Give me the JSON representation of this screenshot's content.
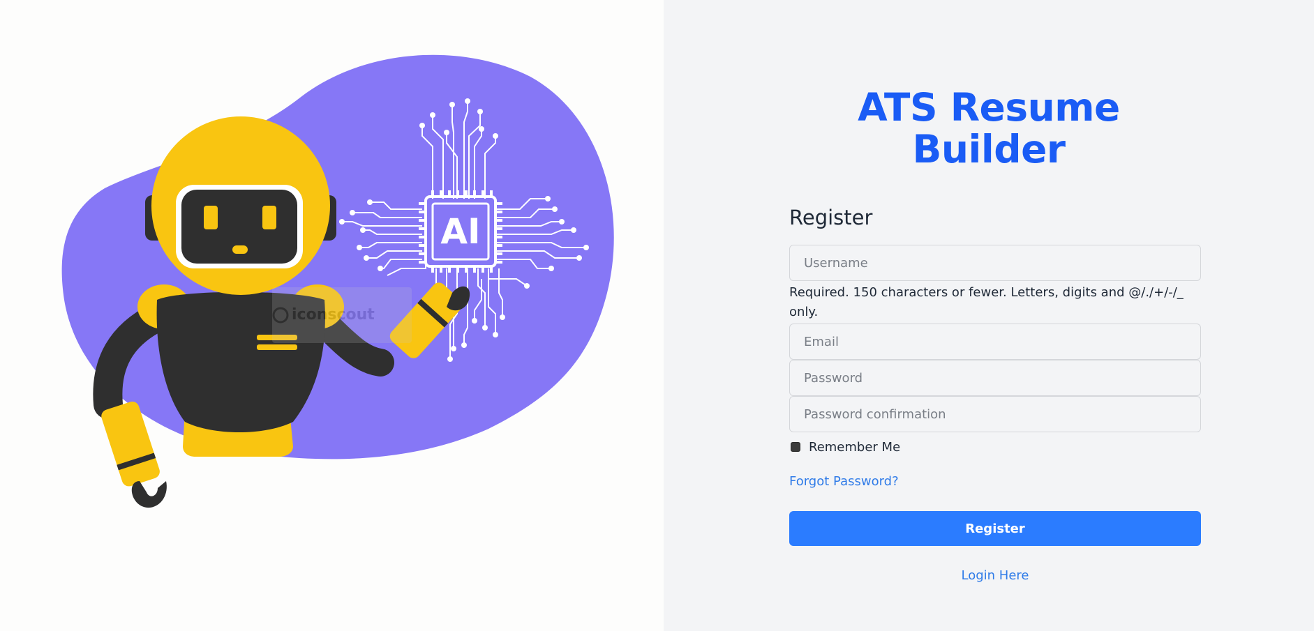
{
  "app": {
    "title_line1": "ATS Resume",
    "title_line2": "Builder"
  },
  "illustration": {
    "name": "robot-ai-chip-illustration",
    "chip_label": "AI",
    "watermark": "iconscout",
    "colors": {
      "blob": "#8677f6",
      "robot_yellow": "#f9c511",
      "robot_dark": "#2f2f2f",
      "circuit": "#ffffff"
    }
  },
  "form": {
    "heading": "Register",
    "username": {
      "placeholder": "Username",
      "value": ""
    },
    "username_help": "Required. 150 characters or fewer. Letters, digits and @/./+/-/_ only.",
    "email": {
      "placeholder": "Email",
      "value": ""
    },
    "password": {
      "placeholder": "Password",
      "value": ""
    },
    "password_confirmation": {
      "placeholder": "Password confirmation",
      "value": ""
    },
    "remember_me": {
      "label": "Remember Me",
      "checked": false
    },
    "forgot_password_label": "Forgot Password?",
    "submit_label": "Register",
    "login_link_label": "Login Here"
  },
  "colors": {
    "accent": "#2b7cff",
    "title": "#1a5cf5",
    "link": "#2f7be8",
    "panel_bg": "#f3f4f6",
    "left_bg": "#fdfdfc"
  }
}
